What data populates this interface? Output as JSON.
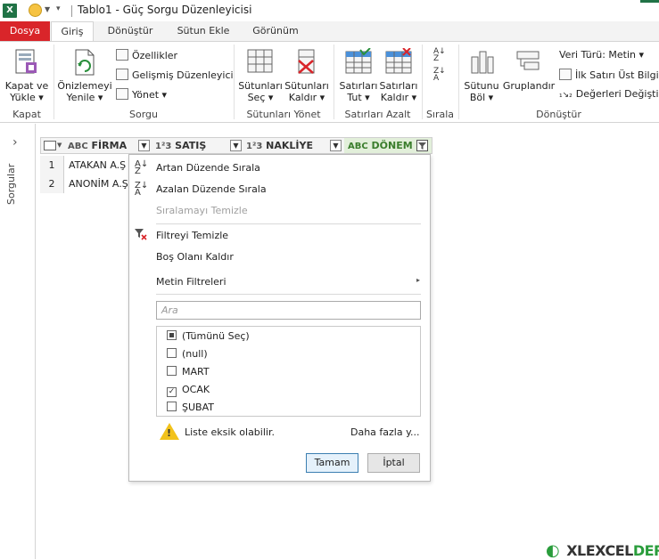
{
  "window": {
    "title": "Tablo1 - Güç Sorgu Düzenleyicisi"
  },
  "tabs": [
    {
      "label": "Dosya"
    },
    {
      "label": "Giriş"
    },
    {
      "label": "Dönüştür"
    },
    {
      "label": "Sütun Ekle"
    },
    {
      "label": "Görünüm"
    }
  ],
  "ribbon": {
    "close_load": {
      "line1": "Kapat ve",
      "line2": "Yükle ▾"
    },
    "refresh": {
      "line1": "Önizlemeyi",
      "line2": "Yenile ▾"
    },
    "properties": "Özellikler",
    "advanced_editor": "Gelişmiş Düzenleyici",
    "manage": "Yönet ▾",
    "choose_cols": {
      "line1": "Sütunları",
      "line2": "Seç ▾"
    },
    "remove_cols": {
      "line1": "Sütunları",
      "line2": "Kaldır ▾"
    },
    "keep_rows": {
      "line1": "Satırları",
      "line2": "Tut ▾"
    },
    "remove_rows": {
      "line1": "Satırları",
      "line2": "Kaldır ▾"
    },
    "split_col": {
      "line1": "Sütunu",
      "line2": "Böl ▾"
    },
    "group_by": "Gruplandır",
    "data_type": "Veri Türü: Metin ▾",
    "first_row_header": "İlk Satırı Üst Bilgi O",
    "replace_values": "Değerleri Değiştir",
    "groups": {
      "close": "Kapat",
      "query": "Sorgu",
      "manage_cols": "Sütunları Yönet",
      "reduce_rows": "Satırları Azalt",
      "sort": "Sırala",
      "transform": "Dönüştür"
    }
  },
  "left_pane": {
    "label": "Sorgular",
    "expand": "›"
  },
  "grid": {
    "columns": [
      {
        "type": "ABC",
        "name": "FİRMA"
      },
      {
        "type": "1²3",
        "name": "SATIŞ"
      },
      {
        "type": "1²3",
        "name": "NAKLİYE"
      },
      {
        "type": "ABC",
        "name": "DÖNEM"
      }
    ],
    "rows": [
      {
        "num": "1",
        "firma": "ATAKAN A.Ş"
      },
      {
        "num": "2",
        "firma": "ANONİM A.Ş"
      }
    ]
  },
  "menu": {
    "sort_asc": "Artan Düzende Sırala",
    "sort_desc": "Azalan Düzende Sırala",
    "clear_sort": "Sıralamayı Temizle",
    "clear_filter": "Filtreyi Temizle",
    "remove_empty": "Boş Olanı Kaldır",
    "text_filters": "Metin Filtreleri",
    "search_placeholder": "Ara",
    "items": [
      {
        "label": "(Tümünü Seç)",
        "state": "indeterminate"
      },
      {
        "label": "(null)",
        "state": "unchecked"
      },
      {
        "label": "MART",
        "state": "unchecked"
      },
      {
        "label": "OCAK",
        "state": "checked"
      },
      {
        "label": "ŞUBAT",
        "state": "unchecked"
      }
    ],
    "warning": "Liste eksik olabilir.",
    "load_more": "Daha fazla y...",
    "ok": "Tamam",
    "cancel": "İptal"
  },
  "logo": {
    "text": "XLEXCEL",
    "brand": "DERO"
  },
  "colors": {
    "file_tab": "#d9252a",
    "excel_green": "#217346",
    "filter_active": "#e2efda",
    "warning": "#f2c21b"
  }
}
